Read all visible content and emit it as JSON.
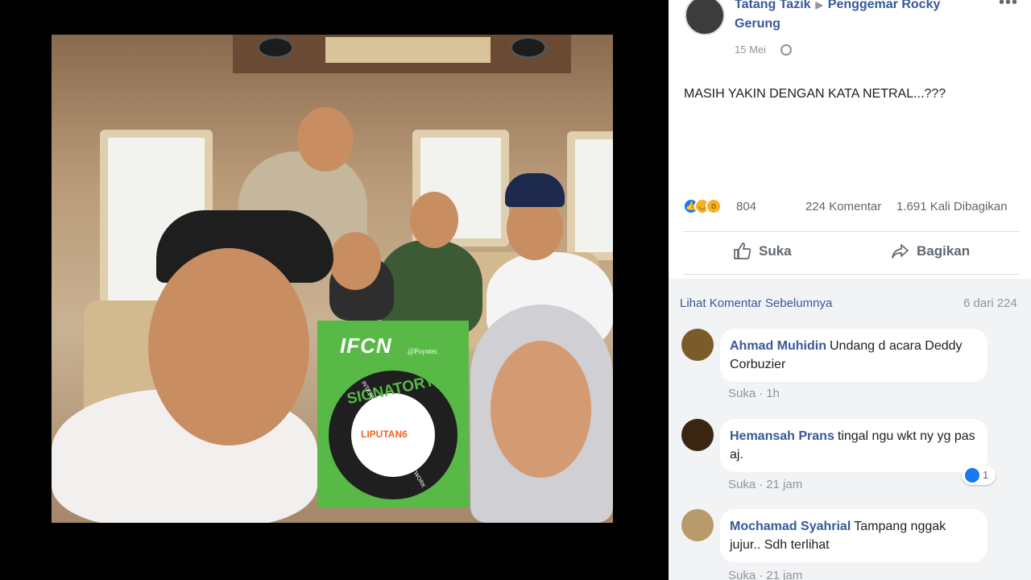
{
  "post": {
    "author_name": "Tatang Tazik",
    "group_name": "Penggemar Rocky Gerung",
    "date": "15 Mei",
    "text": "MASIH YAKIN DENGAN KATA NETRAL...???",
    "reaction_count": "804",
    "comment_count": "224 Komentar",
    "share_count": "1.691 Kali Dibagikan"
  },
  "image": {
    "logo_text": "IFCN",
    "logo_by": "@Poynter.",
    "badge_word": "SIGNATORY",
    "badge_ring_text": "INTERNATIONAL FACT-CHECKING NETWORK",
    "badge_member": "LIPUTAN6"
  },
  "actions": {
    "like_label": "Suka",
    "share_label": "Bagikan"
  },
  "comments_header": {
    "prev_link": "Lihat Komentar Sebelumnya",
    "count": "6 dari 224"
  },
  "comments": [
    {
      "name": "Ahmad Muhidin",
      "text": "Undang d acara Deddy Corbuzier",
      "like": "Suka",
      "time": "1h",
      "reactions": ""
    },
    {
      "name": "Hemansah Prans",
      "text": "tingal ngu wkt ny yg pas aj.",
      "like": "Suka",
      "time": "21 jam",
      "reactions": "1"
    },
    {
      "name": "Mochamad Syahrial",
      "text": "Tampang nggak jujur.. Sdh terlihat",
      "like": "Suka",
      "time": "21 jam",
      "reactions": ""
    }
  ],
  "colors": {
    "link_blue": "#385898",
    "meta_grey": "#90949c",
    "ifcn_green": "#58b947",
    "like_blue": "#1877f2"
  }
}
